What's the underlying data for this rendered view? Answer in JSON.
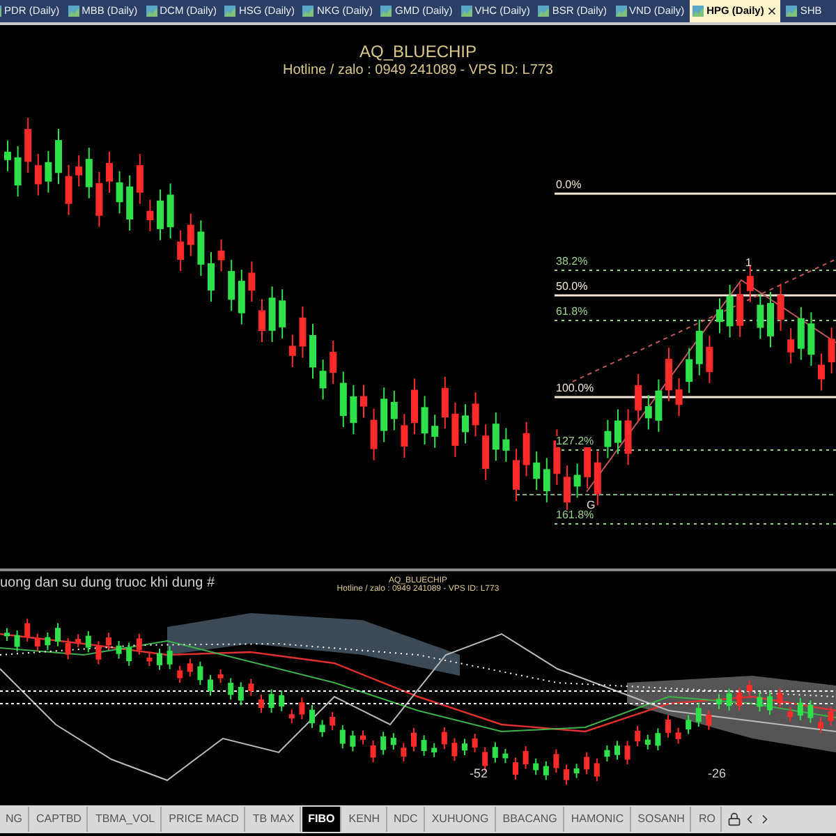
{
  "chart_tabs": [
    {
      "label": "PDR (Daily)",
      "selected": false
    },
    {
      "label": "MBB (Daily)",
      "selected": false
    },
    {
      "label": "DCM (Daily)",
      "selected": false
    },
    {
      "label": "HSG (Daily)",
      "selected": false
    },
    {
      "label": "NKG (Daily)",
      "selected": false
    },
    {
      "label": "GMD (Daily)",
      "selected": false
    },
    {
      "label": "VHC (Daily)",
      "selected": false
    },
    {
      "label": "BSR (Daily)",
      "selected": false
    },
    {
      "label": "VND (Daily)",
      "selected": false
    },
    {
      "label": "HPG (Daily)",
      "selected": true
    },
    {
      "label": "SHB",
      "selected": false
    }
  ],
  "main_chart": {
    "title": "AQ_BLUECHIP",
    "subtitle": "Hotline / zalo : 0949 241089 - VPS ID: L773",
    "fib_levels": [
      {
        "label": "0.0%",
        "kind": "solid"
      },
      {
        "label": "38.2%",
        "kind": "dotted"
      },
      {
        "label": "50.0%",
        "kind": "solid"
      },
      {
        "label": "61.8%",
        "kind": "dotted"
      },
      {
        "label": "100.0%",
        "kind": "solid"
      },
      {
        "label": "127.2%",
        "kind": "dotted"
      },
      {
        "label": "161.8%",
        "kind": "dotted"
      }
    ],
    "wave_marks": [
      "1",
      "G"
    ]
  },
  "indicator_panel": {
    "notice": "uong dan su dung truoc khi dung  #",
    "title": "AQ_BLUECHIP",
    "subtitle": "Hotline / zalo : 0949 241089 - VPS ID: L773",
    "axis_labels": [
      "-52",
      "-26"
    ]
  },
  "template_tabs": [
    {
      "label": "NG",
      "selected": false
    },
    {
      "label": "CAPTBD",
      "selected": false
    },
    {
      "label": "TBMA_VOL",
      "selected": false
    },
    {
      "label": "PRICE MACD",
      "selected": false
    },
    {
      "label": "TB MAX",
      "selected": false
    },
    {
      "label": "FIBO",
      "selected": true
    },
    {
      "label": "KENH",
      "selected": false
    },
    {
      "label": "NDC",
      "selected": false
    },
    {
      "label": "XUHUONG",
      "selected": false
    },
    {
      "label": "BBACANG",
      "selected": false
    },
    {
      "label": "HAMONIC",
      "selected": false
    },
    {
      "label": "SOSANH",
      "selected": false
    },
    {
      "label": "RO",
      "selected": false
    }
  ]
}
